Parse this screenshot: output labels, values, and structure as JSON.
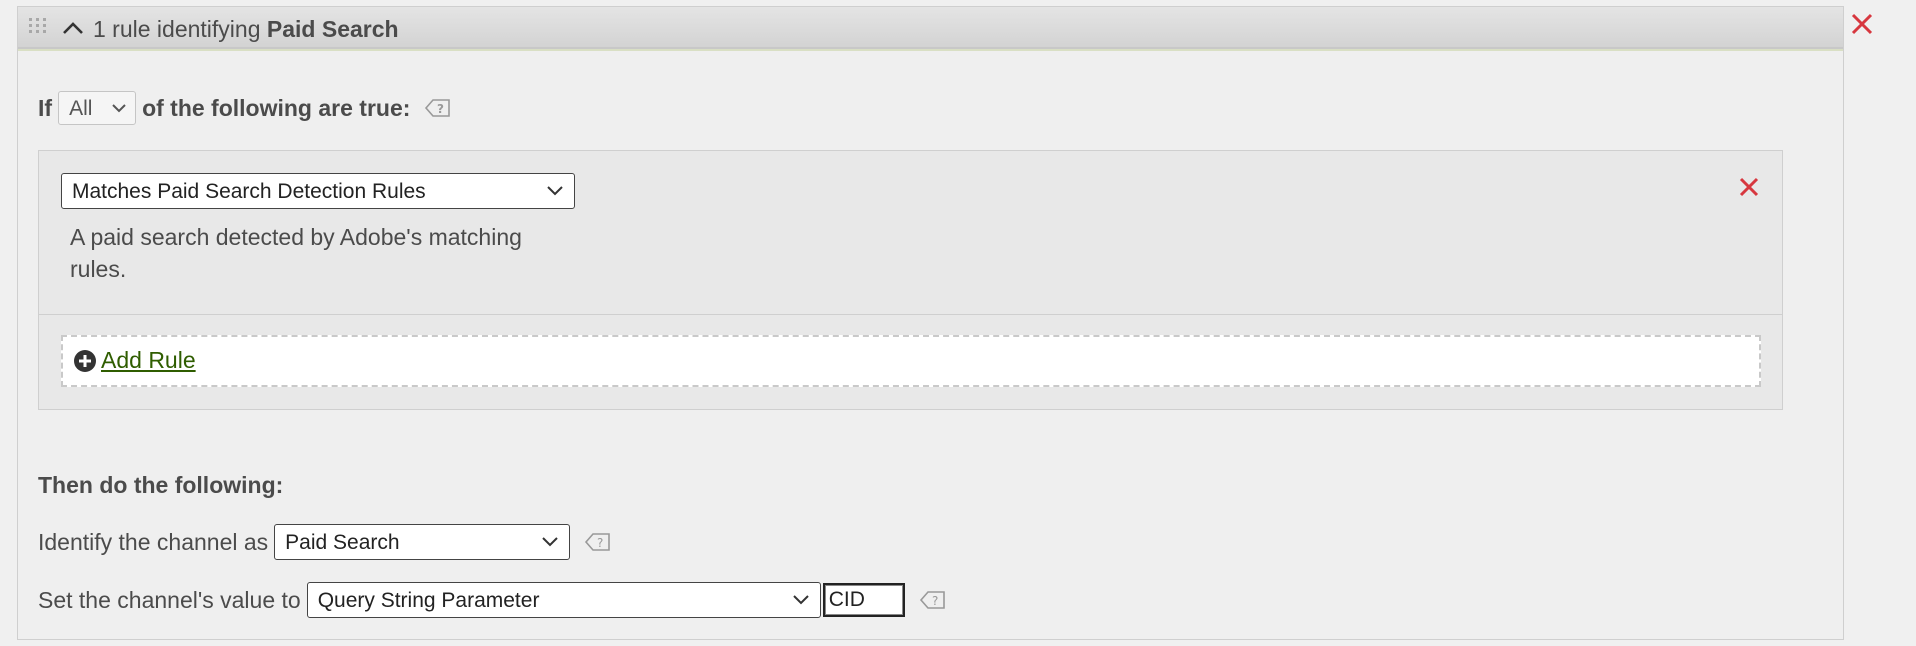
{
  "header": {
    "title_prefix": "1 rule identifying ",
    "title_bold": "Paid Search"
  },
  "condition": {
    "if_label": "If",
    "match_value": "All",
    "suffix": "of the following are true:"
  },
  "rules": [
    {
      "selected": "Matches Paid Search Detection Rules",
      "description": "A paid search detected by Adobe's matching rules."
    }
  ],
  "add_rule_label": "Add Rule",
  "actions": {
    "title": "Then do the following:",
    "identify_label": "Identify the channel as",
    "identify_value": "Paid Search",
    "set_value_label": "Set the channel's value to",
    "set_value_select": "Query String Parameter",
    "set_value_input": "CID"
  },
  "icons": {
    "grip": "drag-handle-icon",
    "collapse": "chevron-up-icon",
    "close": "close-icon",
    "help": "help-tag-icon",
    "add": "plus-circle-icon",
    "dropdown": "chevron-down-icon"
  },
  "colors": {
    "close_red": "#d7373f",
    "link_green": "#2f5d00",
    "header_bg": "#dcdcdc"
  }
}
